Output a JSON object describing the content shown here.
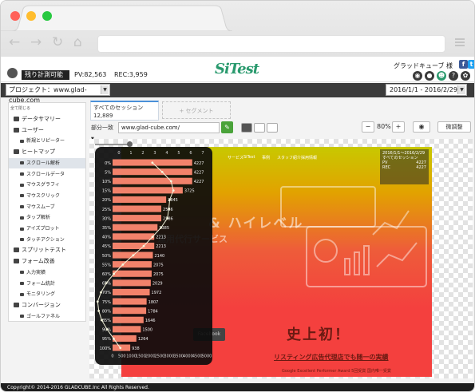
{
  "app": {
    "remaining_label": "残り計測可能",
    "pv_label": "PV:82,563",
    "rec_label": "REC:3,959",
    "logo_text": "SiTest",
    "user_name": "グラッドキューブ 様",
    "brand_color": "#2a9a6e"
  },
  "project": {
    "selected": "プロジェクト：www.glad-cube.com",
    "date_range": "2016/1/1 - 2016/2/29"
  },
  "sidebar": {
    "collapse_label": "全て閉じる",
    "items": [
      {
        "label": "データサマリー",
        "icon": "list-icon",
        "type": "item"
      },
      {
        "label": "ユーザー",
        "icon": "user-icon",
        "type": "item"
      },
      {
        "label": "新規とリピーター",
        "icon": "user-icon",
        "type": "sub"
      },
      {
        "label": "ヒートマップ",
        "icon": "heatmap-icon",
        "type": "item"
      },
      {
        "label": "スクロール解析",
        "icon": "chart-icon",
        "type": "sub",
        "selected": true
      },
      {
        "label": "スクロールデータ",
        "icon": "chart-icon",
        "type": "sub"
      },
      {
        "label": "マウスグラフィ",
        "icon": "chart-icon",
        "type": "sub"
      },
      {
        "label": "マウスクリック",
        "icon": "chart-icon",
        "type": "sub"
      },
      {
        "label": "マウスムーブ",
        "icon": "chart-icon",
        "type": "sub"
      },
      {
        "label": "タップ解析",
        "icon": "chart-icon",
        "type": "sub"
      },
      {
        "label": "アイズプロット",
        "icon": "chart-icon",
        "type": "sub"
      },
      {
        "label": "タッチアクション",
        "icon": "chart-icon",
        "type": "sub"
      },
      {
        "label": "スプリットテスト",
        "icon": "toggle-icon",
        "type": "item"
      },
      {
        "label": "フォーム改善",
        "icon": "form-icon",
        "type": "item"
      },
      {
        "label": "入力実績",
        "icon": "chart-icon",
        "type": "sub"
      },
      {
        "label": "フォーム統計",
        "icon": "chart-icon",
        "type": "sub"
      },
      {
        "label": "モニタリング",
        "icon": "chart-icon",
        "type": "sub"
      },
      {
        "label": "コンバージョン",
        "icon": "handshake-icon",
        "type": "item"
      },
      {
        "label": "ゴールファネル",
        "icon": "chart-icon",
        "type": "sub"
      }
    ]
  },
  "segment": {
    "active_label": "すべてのセッション",
    "active_count": "12,889",
    "add_label": "+ セグメント"
  },
  "filter": {
    "match_label": "部分一致",
    "page_url": "www.glad-cube.com/",
    "zoom": "80%",
    "adjust_label": "微調整"
  },
  "site": {
    "nav": [
      "サービス",
      "SiTest",
      "事例",
      "スタッフ紹介",
      "採用情報"
    ],
    "info_date": "2016/1/1〜2016/2/29",
    "info_segment": "すべてのセッション",
    "info_pv_label": "PV",
    "info_pv": "4227",
    "info_rec_label": "REC",
    "info_rec": "4227",
    "hero_big": "& ハイレベル",
    "hero_sub": "運用代行サービス",
    "hero_main": "史上初！",
    "hero_link": "リスティング広告代理店でも随一の実績",
    "hero_small": "Google Excellent Performer Award 5回受賞 国内唯一受賞",
    "fb_label": "Facebook"
  },
  "chart_data": {
    "type": "bar",
    "orientation": "horizontal",
    "categories": [
      "0%",
      "5%",
      "10%",
      "15%",
      "20%",
      "25%",
      "30%",
      "35%",
      "40%",
      "45%",
      "50%",
      "55%",
      "60%",
      "65%",
      "70%",
      "75%",
      "80%",
      "85%",
      "90%",
      "95%",
      "100%"
    ],
    "values": [
      4227,
      4227,
      4227,
      3725,
      2845,
      2586,
      2586,
      2385,
      2213,
      2213,
      2140,
      2075,
      2075,
      2029,
      1972,
      1807,
      1784,
      1646,
      1500,
      1264,
      938
    ],
    "xticks": [
      "0",
      "500",
      "1000",
      "1500",
      "2000",
      "2500",
      "3000",
      "3500",
      "4000",
      "4500",
      "5000"
    ],
    "topticks": [
      "0",
      "1",
      "2",
      "3",
      "4",
      "5",
      "6",
      "7"
    ],
    "xlim": [
      0,
      5000
    ],
    "bar_color": "#f2826b",
    "curve_color": "#f5f5dc"
  },
  "footer": {
    "copyright": "Copyright© 2014-2016 GLADCUBE.Inc All Rights Reserved."
  }
}
